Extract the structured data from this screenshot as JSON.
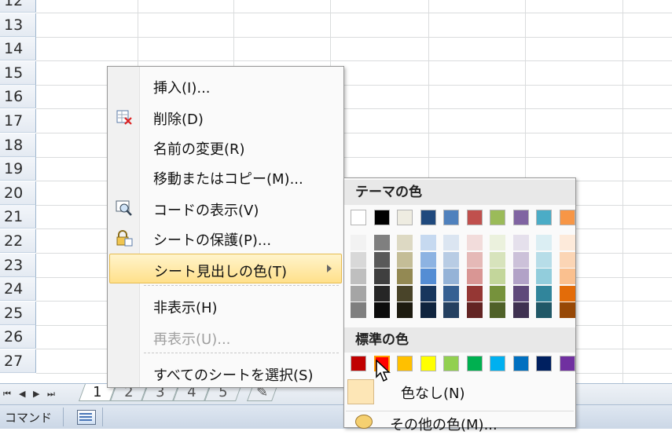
{
  "rows": [
    "12",
    "13",
    "14",
    "15",
    "16",
    "17",
    "18",
    "19",
    "20",
    "21",
    "22",
    "23",
    "24",
    "25",
    "26",
    "27"
  ],
  "tabs": [
    "1",
    "2",
    "3",
    "4",
    "5"
  ],
  "status": {
    "mode": "コマンド"
  },
  "context_menu": {
    "items": [
      {
        "label": "挿入(I)...",
        "icon": ""
      },
      {
        "label": "削除(D)",
        "icon": "delete-sheet-icon"
      },
      {
        "label": "名前の変更(R)",
        "icon": ""
      },
      {
        "label": "移動またはコピー(M)...",
        "icon": ""
      },
      {
        "label": "コードの表示(V)",
        "icon": "view-code-icon"
      },
      {
        "label": "シートの保護(P)...",
        "icon": "protect-sheet-icon"
      },
      {
        "label": "シート見出しの色(T)",
        "icon": "",
        "highlighted": true,
        "submenu": true
      },
      {
        "label": "非表示(H)",
        "icon": ""
      },
      {
        "label": "再表示(U)...",
        "icon": "",
        "disabled": true
      },
      {
        "label": "すべてのシートを選択(S)",
        "icon": ""
      }
    ]
  },
  "color_menu": {
    "theme_heading": "テーマの色",
    "standard_heading": "標準の色",
    "theme_colors": [
      "#ffffff",
      "#000000",
      "#eeece1",
      "#1f497d",
      "#4f81bd",
      "#c0504d",
      "#9bbb59",
      "#8064a2",
      "#4bacc6",
      "#f79646"
    ],
    "theme_shades": [
      [
        "#f2f2f2",
        "#d8d8d8",
        "#bfbfbf",
        "#a5a5a5",
        "#7f7f7f"
      ],
      [
        "#7f7f7f",
        "#595959",
        "#3f3f3f",
        "#262626",
        "#0c0c0c"
      ],
      [
        "#ddd9c3",
        "#c4bd97",
        "#938953",
        "#494429",
        "#1d1b10"
      ],
      [
        "#c6d9f0",
        "#8db3e2",
        "#548dd4",
        "#17365d",
        "#0f243e"
      ],
      [
        "#dbe5f1",
        "#b8cce4",
        "#95b3d7",
        "#366092",
        "#244061"
      ],
      [
        "#f2dcdb",
        "#e5b9b7",
        "#d99694",
        "#953734",
        "#632423"
      ],
      [
        "#ebf1dd",
        "#d7e3bc",
        "#c3d69b",
        "#76923c",
        "#4f6128"
      ],
      [
        "#e5e0ec",
        "#ccc1d9",
        "#b2a2c7",
        "#5f497a",
        "#3f3151"
      ],
      [
        "#dbeef3",
        "#b7dde8",
        "#92cddc",
        "#31859b",
        "#205867"
      ],
      [
        "#fdeada",
        "#fbd5b5",
        "#fac08f",
        "#e36c09",
        "#974806"
      ]
    ],
    "standard_colors": [
      "#c00000",
      "#ff0000",
      "#ffc000",
      "#ffff00",
      "#92d050",
      "#00b050",
      "#00b0f0",
      "#0070c0",
      "#002060",
      "#7030a0"
    ],
    "selected_standard_index": 1,
    "no_color_label": "色なし(N)",
    "more_colors_label": "その他の色(M)..."
  }
}
